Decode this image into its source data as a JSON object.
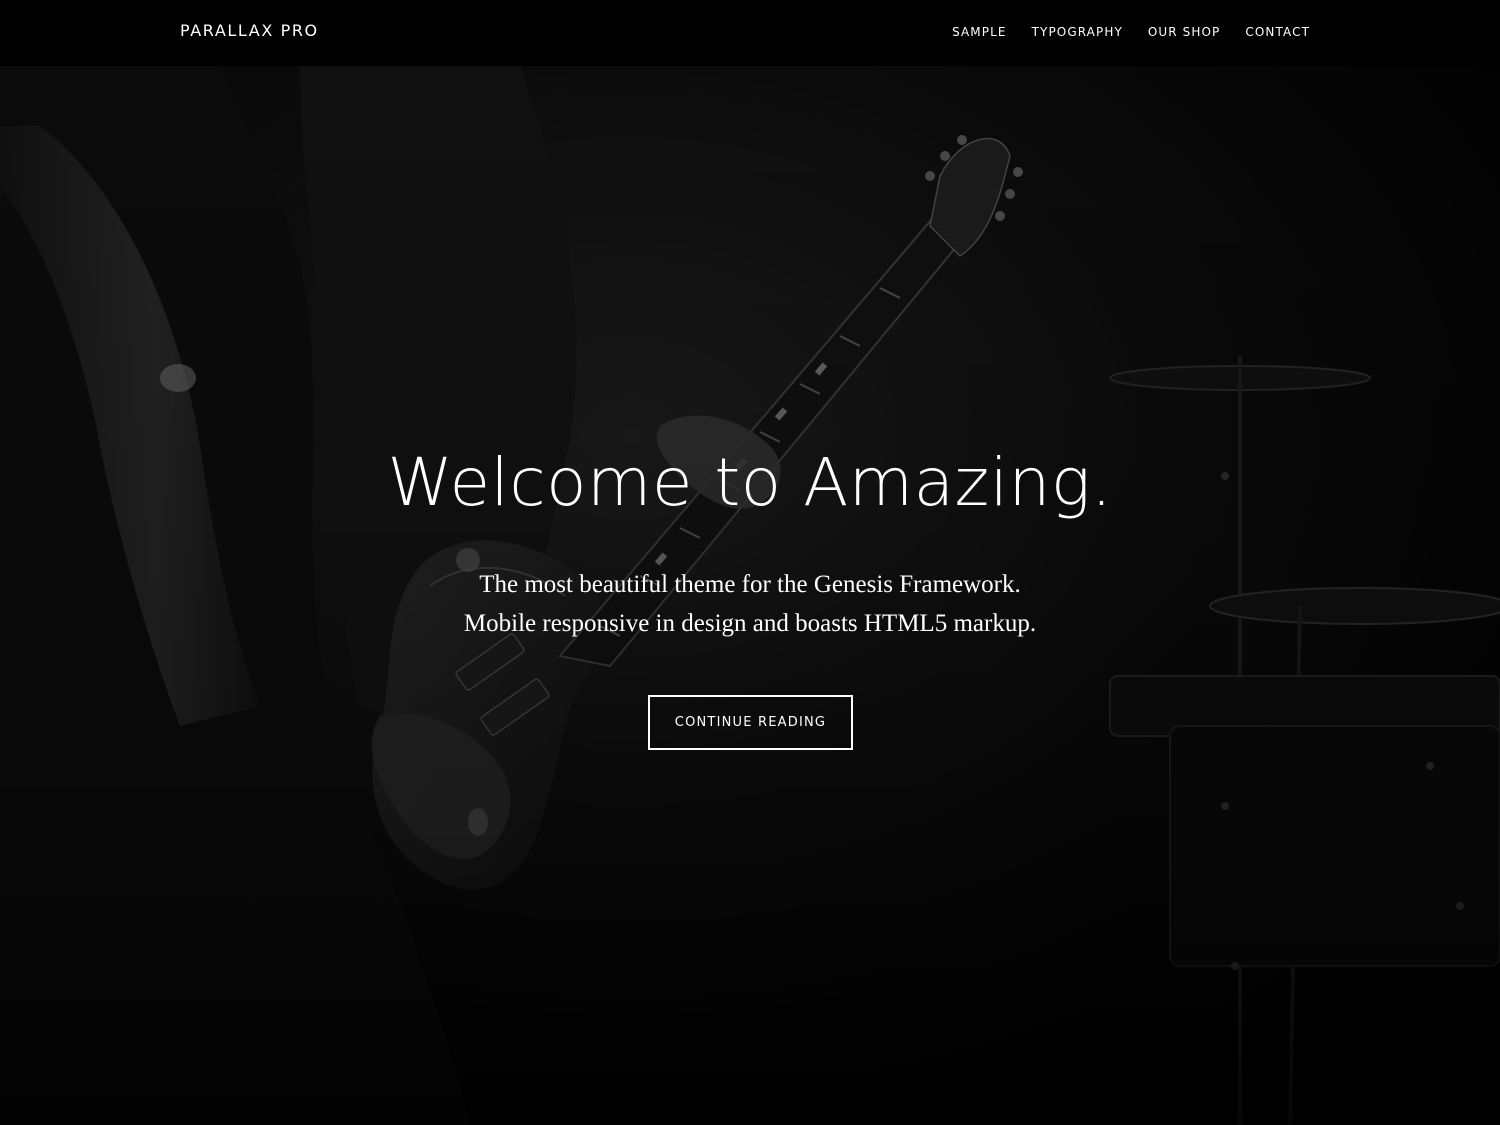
{
  "header": {
    "site_title": "PARALLAX PRO",
    "nav": [
      {
        "label": "SAMPLE"
      },
      {
        "label": "TYPOGRAPHY"
      },
      {
        "label": "OUR SHOP"
      },
      {
        "label": "CONTACT"
      }
    ]
  },
  "hero": {
    "heading": "Welcome to Amazing.",
    "subtitle_line1": "The most beautiful theme for the Genesis Framework.",
    "subtitle_line2": "Mobile responsive in design and boasts HTML5 markup.",
    "button_label": "CONTINUE READING",
    "background_image": "guitarist-playing-electric-guitar-black-and-white"
  },
  "colors": {
    "background": "#000000",
    "text": "#ffffff"
  }
}
